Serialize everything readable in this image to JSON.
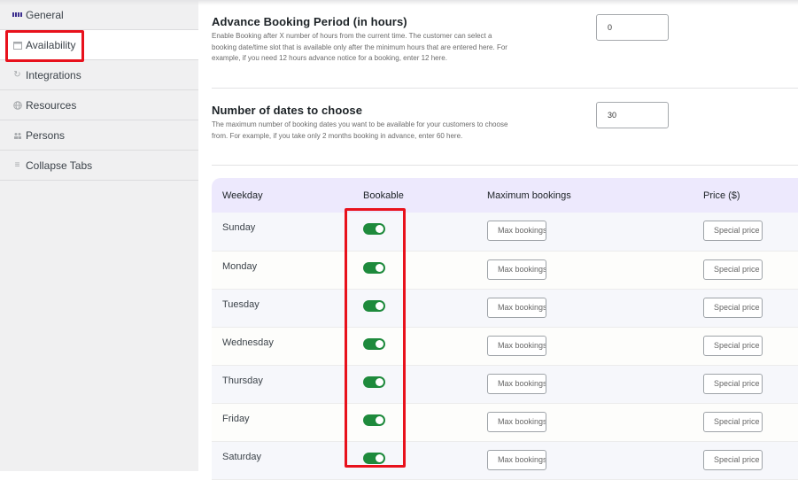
{
  "sidebar": {
    "items": [
      {
        "label": "General",
        "icon": "grid-icon",
        "active": false
      },
      {
        "label": "Availability",
        "icon": "calendar-icon",
        "active": true
      },
      {
        "label": "Integrations",
        "icon": "sync-icon",
        "active": false
      },
      {
        "label": "Resources",
        "icon": "globe-icon",
        "active": false
      },
      {
        "label": "Persons",
        "icon": "people-icon",
        "active": false
      },
      {
        "label": "Collapse Tabs",
        "icon": "list-icon",
        "active": false
      }
    ]
  },
  "settings": {
    "advance_booking": {
      "title": "Advance Booking Period (in hours)",
      "description": "Enable Booking after X number of hours from the current time. The customer can select a booking date/time slot that is available only after the minimum hours that are entered here. For example, if you need 12 hours advance notice for a booking, enter 12 here.",
      "value": "0"
    },
    "number_of_dates": {
      "title": "Number of dates to choose",
      "description": "The maximum number of booking dates you want to be available for your customers to choose from. For example, if you take only 2 months booking in advance, enter 60 here.",
      "value": "30"
    }
  },
  "availability_table": {
    "headers": [
      "Weekday",
      "Bookable",
      "Maximum bookings",
      "Price ($)"
    ],
    "rows": [
      {
        "weekday": "Sunday",
        "bookable": true,
        "max_bookings_placeholder": "Max bookings",
        "price_placeholder": "Special price"
      },
      {
        "weekday": "Monday",
        "bookable": true,
        "max_bookings_placeholder": "Max bookings",
        "price_placeholder": "Special price"
      },
      {
        "weekday": "Tuesday",
        "bookable": true,
        "max_bookings_placeholder": "Max bookings",
        "price_placeholder": "Special price"
      },
      {
        "weekday": "Wednesday",
        "bookable": true,
        "max_bookings_placeholder": "Max bookings",
        "price_placeholder": "Special price"
      },
      {
        "weekday": "Thursday",
        "bookable": true,
        "max_bookings_placeholder": "Max bookings",
        "price_placeholder": "Special price"
      },
      {
        "weekday": "Friday",
        "bookable": true,
        "max_bookings_placeholder": "Max bookings",
        "price_placeholder": "Special price"
      },
      {
        "weekday": "Saturday",
        "bookable": true,
        "max_bookings_placeholder": "Max bookings",
        "price_placeholder": "Special price"
      }
    ]
  },
  "colors": {
    "accent_toggle": "#1e8a3c",
    "highlight_box": "#e8111c",
    "table_header_bg": "#ede9fd"
  }
}
